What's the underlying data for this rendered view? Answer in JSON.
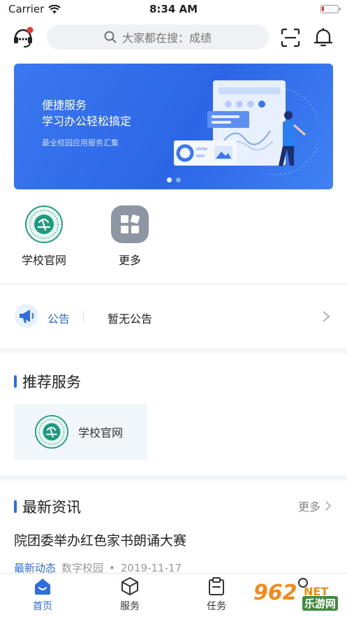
{
  "status_bar": {
    "carrier": "Carrier",
    "time": "8:34 AM",
    "battery_level": 0.15
  },
  "search": {
    "placeholder": "大家都在搜：成绩"
  },
  "banner": {
    "title_line1": "便捷服务",
    "title_line2": "学习办公轻松搞定",
    "subtitle": "最全校园应用服务汇集",
    "page_count": 2,
    "active_page": 1
  },
  "quick_apps": [
    {
      "label": "学校官网",
      "icon": "school-logo-icon"
    },
    {
      "label": "更多",
      "icon": "grid-more-icon"
    }
  ],
  "notice": {
    "label": "公告",
    "text": "暂无公告"
  },
  "recommended": {
    "title": "推荐服务",
    "items": [
      {
        "label": "学校官网",
        "icon": "school-logo-icon"
      }
    ]
  },
  "news": {
    "title": "最新资讯",
    "more_label": "更多",
    "items": [
      {
        "title": "院团委举办红色家书朗诵大赛",
        "tag": "最新动态",
        "source": "数字校园",
        "date": "2019-11-17"
      }
    ]
  },
  "tabs": [
    {
      "label": "首页",
      "icon": "home-icon",
      "active": true
    },
    {
      "label": "服务",
      "icon": "cube-icon",
      "active": false
    },
    {
      "label": "任务",
      "icon": "clipboard-icon",
      "active": false
    },
    {
      "label": "",
      "icon": "user-icon",
      "active": false
    }
  ],
  "watermark": {
    "number": "962",
    "suffix": "NET",
    "name": "乐游网"
  },
  "colors": {
    "accent": "#2e6ee0",
    "banner": "#3a78f0",
    "badge": "#e53935",
    "watermark": "#f28a1a"
  }
}
